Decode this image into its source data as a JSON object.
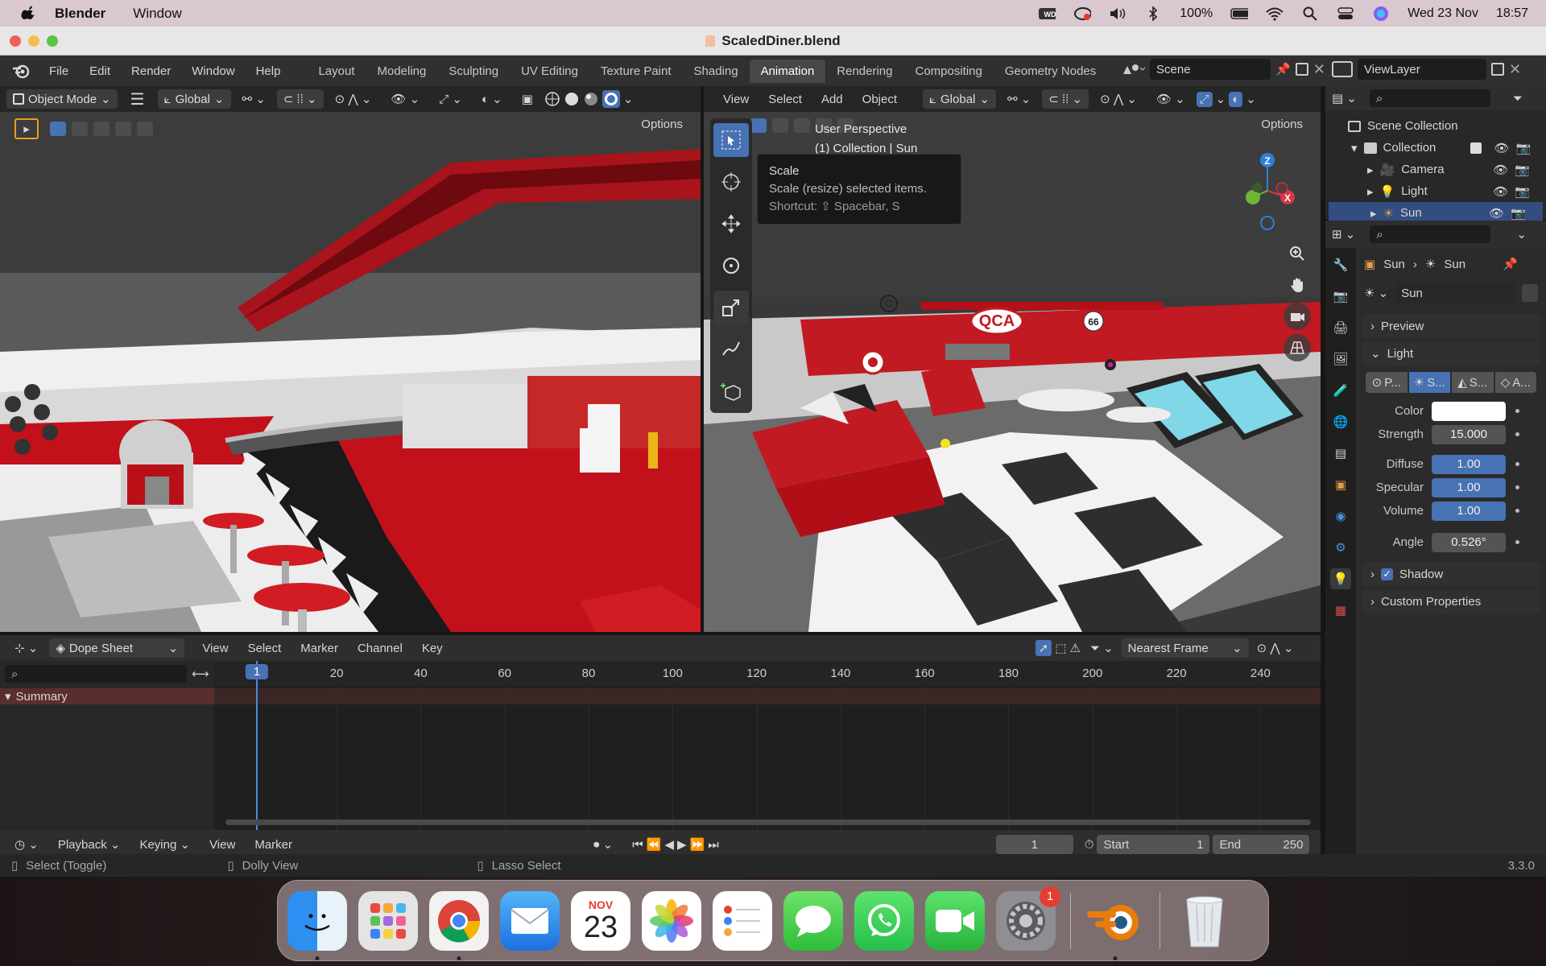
{
  "mac_menubar": {
    "app_name": "Blender",
    "menu": [
      "Window"
    ],
    "battery": "100%",
    "date": "Wed 23 Nov",
    "time": "18:57"
  },
  "window": {
    "title": "ScaledDiner.blend"
  },
  "topbar": {
    "menus": [
      "File",
      "Edit",
      "Render",
      "Window",
      "Help"
    ],
    "workspaces": [
      "Layout",
      "Modeling",
      "Sculpting",
      "UV Editing",
      "Texture Paint",
      "Shading",
      "Animation",
      "Rendering",
      "Compositing",
      "Geometry Nodes"
    ],
    "active_workspace": "Animation",
    "scene": "Scene",
    "view_layer": "ViewLayer"
  },
  "viewport_left": {
    "mode": "Object Mode",
    "orientation": "Global",
    "options": "Options"
  },
  "viewport_right": {
    "menus": [
      "View",
      "Select",
      "Add",
      "Object"
    ],
    "orientation": "Global",
    "options": "Options",
    "info_line1": "User Perspective",
    "info_line2": "(1) Collection | Sun",
    "tooltip": {
      "title": "Scale",
      "description": "Scale (resize) selected items.",
      "shortcut": "Shortcut: ⇧ Spacebar, S"
    },
    "gizmo": {
      "z": "Z",
      "x": "X"
    }
  },
  "outliner": {
    "root": "Scene Collection",
    "collection": "Collection",
    "items": [
      "Camera",
      "Light",
      "Sun"
    ]
  },
  "properties": {
    "breadcrumb_object": "Sun",
    "breadcrumb_data": "Sun",
    "datablock": "Sun",
    "panels": {
      "preview": "Preview",
      "light": "Light",
      "shadow": "Shadow",
      "custom": "Custom Properties"
    },
    "light_types": [
      "P...",
      "S...",
      "S...",
      "A..."
    ],
    "fields": [
      {
        "label": "Color",
        "value": ""
      },
      {
        "label": "Strength",
        "value": "15.000"
      },
      {
        "label": "Diffuse",
        "value": "1.00"
      },
      {
        "label": "Specular",
        "value": "1.00"
      },
      {
        "label": "Volume",
        "value": "1.00"
      },
      {
        "label": "Angle",
        "value": "0.526°"
      }
    ],
    "colors": {
      "accent": "#4772b3",
      "light_color": "#ffffff"
    }
  },
  "dopesheet": {
    "editor": "Dope Sheet",
    "menus": [
      "View",
      "Select",
      "Marker",
      "Channel",
      "Key"
    ],
    "snap": "Nearest Frame",
    "summary": "Summary",
    "current_frame": "1",
    "ticks": [
      "20",
      "40",
      "60",
      "80",
      "100",
      "120",
      "140",
      "160",
      "180",
      "200",
      "220",
      "240"
    ]
  },
  "timeline": {
    "menus": [
      "Playback",
      "Keying",
      "View",
      "Marker"
    ],
    "frame": "1",
    "start_label": "Start",
    "start": "1",
    "end_label": "End",
    "end": "250"
  },
  "statusbar": {
    "left": "Select (Toggle)",
    "middle": "Dolly View",
    "right": "Lasso Select",
    "version": "3.3.0"
  },
  "dock": {
    "apps": [
      "finder",
      "launchpad",
      "chrome",
      "mail",
      "calendar",
      "photos",
      "reminders",
      "messages",
      "whatsapp",
      "facetime",
      "system-preferences",
      "blender",
      "trash"
    ],
    "calendar_month": "NOV",
    "calendar_day": "23",
    "settings_badge": "1"
  }
}
